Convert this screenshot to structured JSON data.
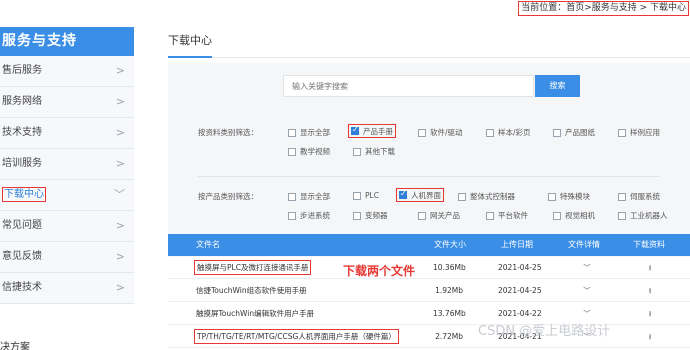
{
  "breadcrumb": "当前位置：首页>服务与支持 > 下载中心",
  "sidebar": {
    "title": "服务与支持",
    "items": [
      {
        "label": "售后服务"
      },
      {
        "label": "服务网络"
      },
      {
        "label": "技术支持"
      },
      {
        "label": "培训服务"
      },
      {
        "label": "下载中心"
      },
      {
        "label": "常见问题"
      },
      {
        "label": "意见反馈"
      },
      {
        "label": "信捷技术"
      }
    ],
    "extra": "决方案"
  },
  "main": {
    "title": "下载中心",
    "search": {
      "placeholder": "输入关键字搜索",
      "button": "搜索"
    },
    "filter_doc": {
      "label": "按资料类别筛选：",
      "options": [
        "显示全部",
        "产品手册",
        "软件/驱动",
        "样本/彩页",
        "产品图纸",
        "样例应用",
        "教学视频",
        "其他下载"
      ]
    },
    "filter_product": {
      "label": "按产品类别筛选：",
      "options": [
        "显示全部",
        "PLC",
        "人机界面",
        "整体式控制器",
        "特殊模块",
        "伺服系统",
        "步进系统",
        "变频器",
        "网关产品",
        "平台软件",
        "视觉相机",
        "工业机器人"
      ]
    },
    "table": {
      "headers": [
        "文件名",
        "文件大小",
        "上传日期",
        "文件详情",
        "下载资料"
      ],
      "rows": [
        {
          "name": "触摸屏与PLC及微打连接通讯手册",
          "size": "10.36Mb",
          "date": "2021-04-25"
        },
        {
          "name": "信捷TouchWin组态软件使用手册",
          "size": "1.92Mb",
          "date": "2021-04-25"
        },
        {
          "name": "触摸屏TouchWin编辑软件用户手册",
          "size": "13.76Mb",
          "date": "2021-04-22"
        },
        {
          "name": "TP/TH/TG/TE/RT/MTG/CCSG人机界面用户手册（硬件篇）",
          "size": "2.72Mb",
          "date": "2021-04-21"
        }
      ]
    },
    "annotation": "下载两个文件"
  },
  "watermark": "CSDN @爱上电路设计",
  "icons": {
    "chevron": "chevron-right-icon",
    "expand": "chevron-down-icon",
    "download": "download-icon"
  },
  "colors": {
    "accent": "#3a8ee6",
    "highlight": "#e53935"
  }
}
